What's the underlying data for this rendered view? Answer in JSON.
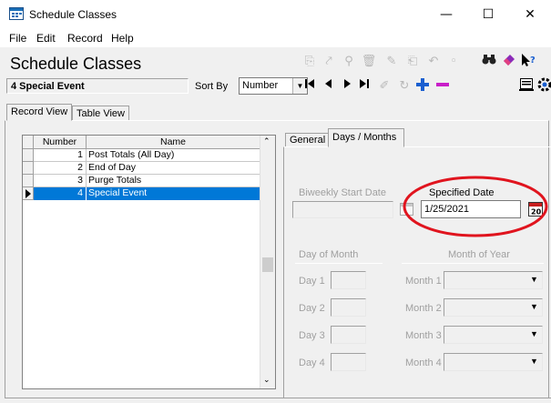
{
  "window": {
    "title": "Schedule Classes",
    "minimize": "—",
    "maximize": "☐",
    "close": "✕"
  },
  "menu": [
    "File",
    "Edit",
    "Record",
    "Help"
  ],
  "header": {
    "form_title": "Schedule Classes",
    "current_record": "4 Special Event",
    "sort_by_label": "Sort By",
    "sort_by_value": "Number"
  },
  "tabs": {
    "record_view": "Record View",
    "table_view": "Table View"
  },
  "grid": {
    "columns": [
      "Number",
      "Name"
    ],
    "rows": [
      {
        "number": "1",
        "name": "Post Totals (All Day)"
      },
      {
        "number": "2",
        "name": "End of Day"
      },
      {
        "number": "3",
        "name": "Purge Totals"
      },
      {
        "number": "4",
        "name": "Special Event"
      }
    ],
    "selected_index": 3
  },
  "detail_tabs": {
    "general": "General",
    "days_months": "Days / Months"
  },
  "detail": {
    "biweekly_label": "Biweekly Start Date",
    "specified_date_label": "Specified Date",
    "specified_date_value": "1/25/2021",
    "day_of_month_label": "Day of Month",
    "month_of_year_label": "Month of Year",
    "days": [
      "Day 1",
      "Day 2",
      "Day 3",
      "Day 4"
    ],
    "months": [
      "Month 1",
      "Month 2",
      "Month 3",
      "Month 4"
    ]
  },
  "colors": {
    "selection": "#0078d7",
    "highlight_circle": "#e0141e",
    "add_icon": "#1a5fd0",
    "delete_icon": "#c81ec8"
  },
  "icons": {
    "toolbar": [
      "new-record-icon",
      "copy-record-icon",
      "find-record-icon",
      "delete-record-icon",
      "first-record-icon",
      "prev-record-icon",
      "next-record-icon",
      "last-record-icon",
      "add-icon",
      "remove-icon",
      "search-icon",
      "help-icon"
    ]
  }
}
